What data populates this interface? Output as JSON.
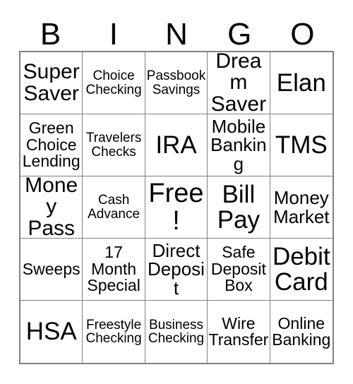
{
  "card": {
    "headers": [
      "B",
      "I",
      "N",
      "G",
      "O"
    ],
    "cells": [
      {
        "text": "Super\nSaver",
        "size": "sz-ml"
      },
      {
        "text": "Choice\nChecking",
        "size": "sz-xs"
      },
      {
        "text": "Passbook\nSavings",
        "size": "sz-xs"
      },
      {
        "text": "Dream\nSaver",
        "size": "sz-ml"
      },
      {
        "text": "Elan",
        "size": "sz-lg"
      },
      {
        "text": "Green\nChoice\nLending",
        "size": "sz-sm"
      },
      {
        "text": "Travelers\nChecks",
        "size": "sz-xs"
      },
      {
        "text": "IRA",
        "size": "sz-lg"
      },
      {
        "text": "Mobile\nBanking",
        "size": "sz-md"
      },
      {
        "text": "TMS",
        "size": "sz-lg"
      },
      {
        "text": "Money\nPass",
        "size": "sz-ml"
      },
      {
        "text": "Cash\nAdvance",
        "size": "sz-xs"
      },
      {
        "text": "Free!",
        "size": "sz-xl"
      },
      {
        "text": "Bill\nPay",
        "size": "sz-lg"
      },
      {
        "text": "Money\nMarket",
        "size": "sz-md"
      },
      {
        "text": "Sweeps",
        "size": "sz-sm"
      },
      {
        "text": "17\nMonth\nSpecial",
        "size": "sz-sm"
      },
      {
        "text": "Direct\nDeposit",
        "size": "sz-md"
      },
      {
        "text": "Safe\nDeposit\nBox",
        "size": "sz-sm"
      },
      {
        "text": "Debit\nCard",
        "size": "sz-lg"
      },
      {
        "text": "HSA",
        "size": "sz-lg"
      },
      {
        "text": "Freestyle\nChecking",
        "size": "sz-xs"
      },
      {
        "text": "Business\nChecking",
        "size": "sz-xs"
      },
      {
        "text": "Wire\nTransfer",
        "size": "sz-sm"
      },
      {
        "text": "Online\nBanking",
        "size": "sz-sm"
      }
    ]
  },
  "colors": {
    "background": "#ffffff",
    "text": "#000000",
    "grid_border": "#808080"
  }
}
